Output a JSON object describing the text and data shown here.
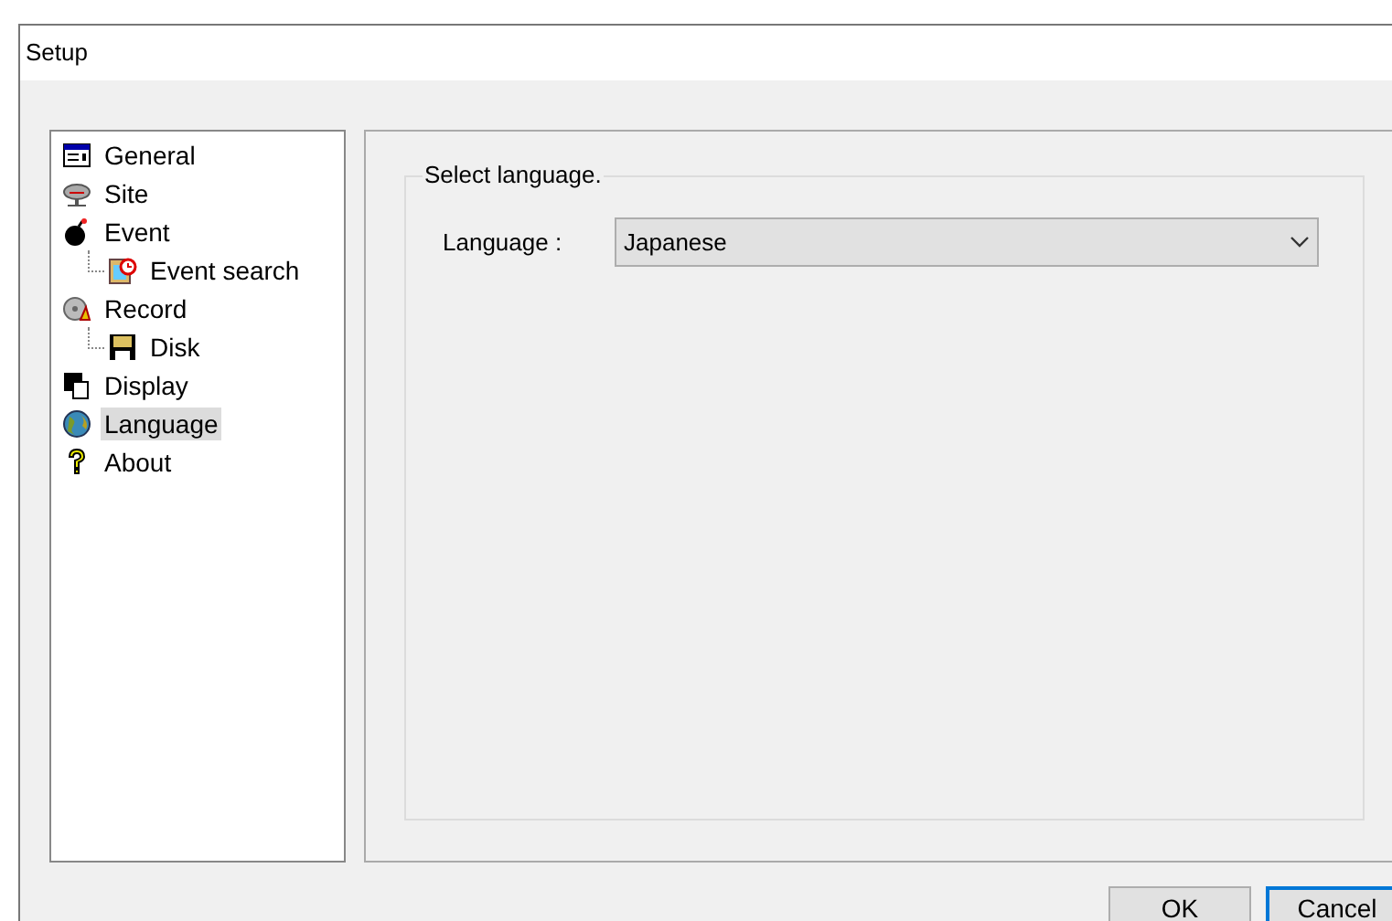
{
  "window": {
    "title": "Setup"
  },
  "sidebar": {
    "items": [
      {
        "label": "General",
        "selected": false
      },
      {
        "label": "Site",
        "selected": false
      },
      {
        "label": "Event",
        "selected": false,
        "children": [
          {
            "label": "Event search",
            "selected": false
          }
        ]
      },
      {
        "label": "Record",
        "selected": false,
        "children": [
          {
            "label": "Disk",
            "selected": false
          }
        ]
      },
      {
        "label": "Display",
        "selected": false
      },
      {
        "label": "Language",
        "selected": true
      },
      {
        "label": "About",
        "selected": false
      }
    ]
  },
  "group": {
    "title": "Select language.",
    "field_label": "Language :",
    "value": "Japanese"
  },
  "buttons": [
    {
      "label": "OK",
      "selected": false
    },
    {
      "label": "Cancel",
      "selected": true
    }
  ]
}
